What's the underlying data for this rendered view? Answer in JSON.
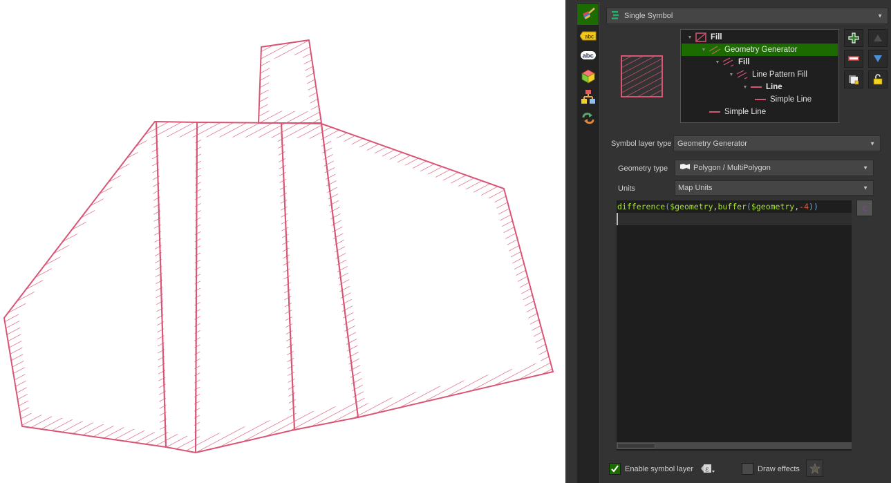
{
  "map": {
    "symbol_color": "#d95575",
    "fill_color": "#ffffff",
    "description": "Polygons rendered with Geometry Generator difference(buffer) producing hatched inner border"
  },
  "toolstrip": {
    "items": [
      {
        "name": "symbology-tab",
        "icon": "paintbrush-icon",
        "active": true
      },
      {
        "name": "labels-tab",
        "icon": "label-abc-icon",
        "active": false
      },
      {
        "name": "masks-tab",
        "icon": "mask-abc-icon",
        "active": false
      },
      {
        "name": "3d-view-tab",
        "icon": "cube-icon",
        "active": false
      },
      {
        "name": "diagrams-tab",
        "icon": "diagram-icon",
        "active": false
      },
      {
        "name": "history-tab",
        "icon": "undo-redo-icon",
        "active": false
      }
    ]
  },
  "renderer": {
    "selected": "Single Symbol",
    "icon": "single-symbol-icon"
  },
  "symbol_tree": {
    "rows": [
      {
        "label": "Fill",
        "level": 0,
        "bold": true,
        "icon": "fill-icon",
        "expander": true,
        "selected": false
      },
      {
        "label": "Geometry Generator",
        "level": 1,
        "bold": false,
        "icon": "geometry-generator-icon",
        "expander": true,
        "selected": true
      },
      {
        "label": "Fill",
        "level": 2,
        "bold": true,
        "icon": "fill-hatch-icon",
        "expander": true,
        "selected": false
      },
      {
        "label": "Line Pattern Fill",
        "level": 3,
        "bold": false,
        "icon": "line-pattern-fill-icon",
        "expander": true,
        "selected": false
      },
      {
        "label": "Line",
        "level": 4,
        "bold": true,
        "icon": "line-icon",
        "expander": true,
        "selected": false
      },
      {
        "label": "Simple Line",
        "level": 5,
        "bold": false,
        "icon": "simple-line-icon",
        "expander": false,
        "selected": false
      },
      {
        "label": "Simple Line",
        "level": 1,
        "bold": false,
        "icon": "simple-line-icon",
        "expander": false,
        "selected": false
      }
    ]
  },
  "side_buttons": {
    "add": "add-layer-icon",
    "up": "move-up-icon",
    "remove": "remove-layer-icon",
    "down": "move-down-icon",
    "duplicate": "duplicate-icon",
    "lock": "lock-open-icon"
  },
  "form": {
    "symbol_layer_type_label": "Symbol layer type",
    "symbol_layer_type_value": "Geometry Generator",
    "geometry_type_label": "Geometry type",
    "geometry_type_value": "Polygon / MultiPolygon",
    "units_label": "Units",
    "units_value": "Map Units"
  },
  "expression": {
    "tokens": [
      {
        "text": "difference",
        "color": "#a6e22e"
      },
      {
        "text": "(",
        "color": "#6fa8dc"
      },
      {
        "text": "$geometry",
        "color": "#a6e22e"
      },
      {
        "text": ",",
        "color": "#d0d0d0"
      },
      {
        "text": "buffer",
        "color": "#a6e22e"
      },
      {
        "text": "(",
        "color": "#6fa8dc"
      },
      {
        "text": "$geometry",
        "color": "#a6e22e"
      },
      {
        "text": ",",
        "color": "#d0d0d0"
      },
      {
        "text": "-4",
        "color": "#e0603a"
      },
      {
        "text": "))",
        "color": "#6fa8dc"
      }
    ],
    "full_text": "difference($geometry,buffer($geometry,-4))",
    "scroll_fraction": 0.16
  },
  "footer": {
    "enable_label": "Enable symbol layer",
    "enable_checked": true,
    "draw_effects_label": "Draw effects",
    "draw_effects_checked": false
  }
}
